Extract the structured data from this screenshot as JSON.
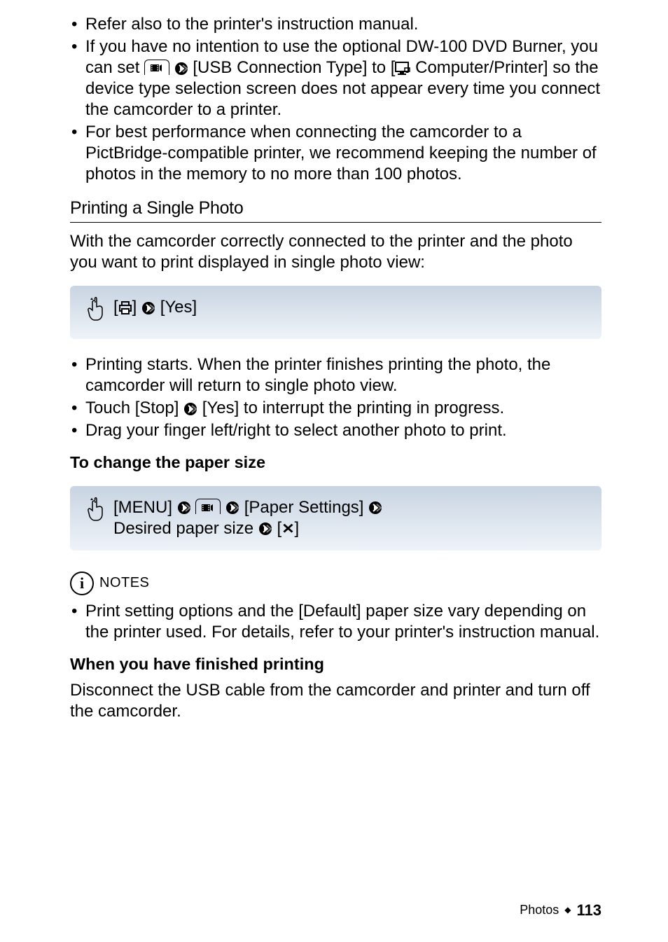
{
  "bullets_top": {
    "b1": "Refer also to the printer's instruction manual.",
    "b2_a": "If you have no intention to use the optional DW-100 DVD Burner, you can set ",
    "b2_b": " [USB Connection Type] to [",
    "b2_c": " Computer/Printer] so the device type selection screen does not appear every time you connect the camcorder to a printer.",
    "b3": "For best performance when connecting the camcorder to a PictBridge-compatible printer, we recommend keeping the number of photos in the memory to no more than 100 photos."
  },
  "section1": {
    "heading": "Printing a Single Photo",
    "intro": "With the camcorder correctly connected to the printer and the photo you want to print displayed in single photo view:",
    "step_a": "[",
    "step_b": "] ",
    "step_c": " [Yes]",
    "bullets": {
      "b1": "Printing starts. When the printer finishes printing the photo, the camcorder will return to single photo view.",
      "b2_a": "Touch [Stop] ",
      "b2_b": " [Yes] to interrupt the printing in progress.",
      "b3": "Drag your finger left/right to select another photo to print."
    }
  },
  "papersize": {
    "heading": "To change the paper size",
    "line1_a": "[MENU] ",
    "line1_b": " [Paper Settings] ",
    "line2_a": "Desired paper size ",
    "line2_b": " [",
    "line2_c": "]"
  },
  "notes": {
    "label": "NOTES",
    "bullet": "Print setting options and the [Default] paper size vary depending on the printer used. For details, refer to your printer's instruction manual."
  },
  "finished": {
    "heading": "When you have finished printing",
    "body": "Disconnect the USB cable from the camcorder and printer and turn off the camcorder."
  },
  "footer": {
    "section": "Photos",
    "page": "113"
  },
  "glyphs": {
    "info": "i",
    "close": "✕"
  }
}
